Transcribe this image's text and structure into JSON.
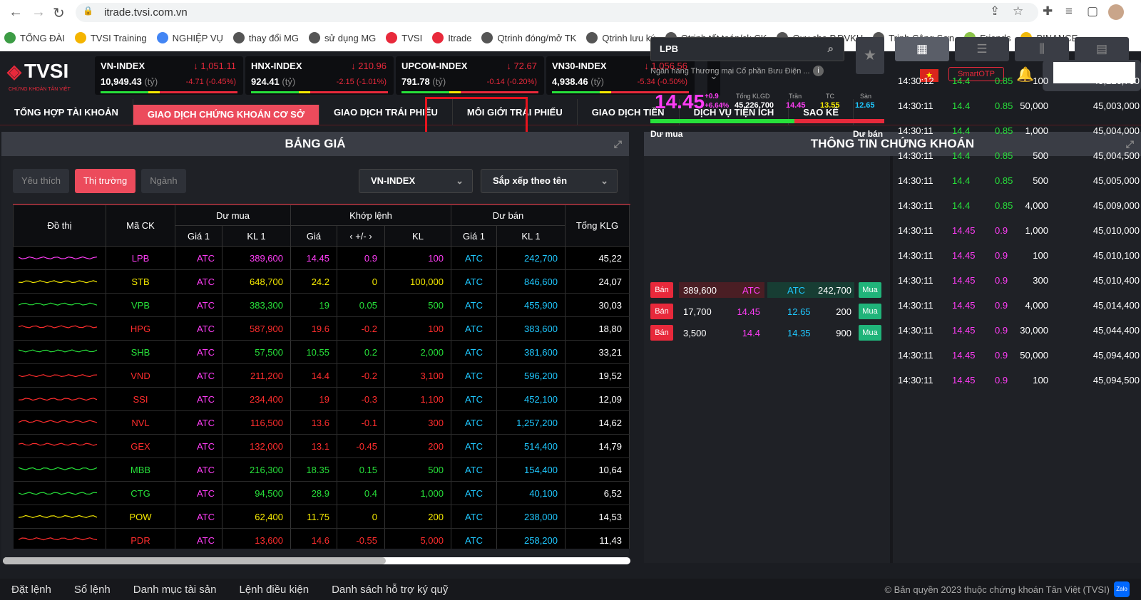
{
  "browser": {
    "url": "itrade.tvsi.com.vn",
    "bookmarks": [
      {
        "label": "TỔNG ĐÀI",
        "color": "#3c9c45"
      },
      {
        "label": "TVSI Training",
        "color": "#f4b400"
      },
      {
        "label": "NGHIỆP VỤ",
        "color": "#4285f4"
      },
      {
        "label": "thay đổi MG",
        "color": "#555"
      },
      {
        "label": "sử dụng MG",
        "color": "#555"
      },
      {
        "label": "TVSI",
        "color": "#e8293b"
      },
      {
        "label": "Itrade",
        "color": "#e8293b"
      },
      {
        "label": "Qtrinh đóng/mở TK",
        "color": "#555"
      },
      {
        "label": "Qtrinh lưu ký",
        "color": "#555"
      },
      {
        "label": "Qtrinh tất toán/ck CK",
        "color": "#555"
      },
      {
        "label": "Quy che P.DVKH",
        "color": "#555"
      },
      {
        "label": "Trịnh Công Sơn",
        "color": "#555"
      },
      {
        "label": "Friends",
        "color": "#8bc34a"
      },
      {
        "label": "BINANCE",
        "color": "#f0b90b"
      }
    ]
  },
  "logo": {
    "text": "TVSI",
    "subtitle": "CHỨNG KHOÁN TÂN VIỆT"
  },
  "indices": [
    {
      "name": "VN-INDEX",
      "price": "1,051.11",
      "volume": "10,949.43",
      "unit": "(tỷ)",
      "change": "-4.71",
      "pct": "(-0.45%)"
    },
    {
      "name": "HNX-INDEX",
      "price": "210.96",
      "volume": "924.41",
      "unit": "(tỷ)",
      "change": "-2.15",
      "pct": "(-1.01%)"
    },
    {
      "name": "UPCOM-INDEX",
      "price": "72.67",
      "volume": "791.78",
      "unit": "(tỷ)",
      "change": "-0.14",
      "pct": "(-0.20%)"
    },
    {
      "name": "VN30-INDEX",
      "price": "1,056.56",
      "volume": "4,938.46",
      "unit": "(tỷ)",
      "change": "-5.34",
      "pct": "(-0.50%)"
    }
  ],
  "header": {
    "smartotp": "SmartOTP",
    "flag": "★"
  },
  "menu": [
    "TỔNG HỢP TÀI KHOẢN",
    "GIAO DỊCH CHỨNG KHOÁN CƠ SỞ",
    "GIAO DỊCH TRÁI PHIẾU",
    "MÔI GIỚI TRÁI PHIẾU",
    "GIAO DỊCH TIỀN",
    "DỊCH VỤ TIỆN ÍCH",
    "SAO KÊ"
  ],
  "board": {
    "title": "BẢNG GIÁ",
    "tabs": [
      "Yêu thích",
      "Thị trường",
      "Ngành"
    ],
    "index_select": "VN-INDEX",
    "sort_select": "Sắp xếp theo tên",
    "headers": {
      "chart": "Đồ thị",
      "symbol": "Mã CK",
      "bid": "Dư mua",
      "match": "Khớp lệnh",
      "ask": "Dư bán",
      "total": "Tổng KLG",
      "price1": "Giá 1",
      "vol1": "KL 1",
      "price": "Giá",
      "change": "+/-",
      "vol": "KL"
    },
    "rows": [
      {
        "sym": "LPB",
        "bp": "ATC",
        "bv": "389,600",
        "mp": "14.45",
        "mc": "0.9",
        "mv": "100",
        "ap": "ATC",
        "av": "242,700",
        "tot": "45,22",
        "color": "#ff3df6"
      },
      {
        "sym": "STB",
        "bp": "ATC",
        "bv": "648,700",
        "mp": "24.2",
        "mc": "0",
        "mv": "100,000",
        "ap": "ATC",
        "av": "846,600",
        "tot": "24,07",
        "color": "#f5e900"
      },
      {
        "sym": "VPB",
        "bp": "ATC",
        "bv": "383,300",
        "mp": "19",
        "mc": "0.05",
        "mv": "500",
        "ap": "ATC",
        "av": "455,900",
        "tot": "30,03",
        "color": "#27e03a"
      },
      {
        "sym": "HPG",
        "bp": "ATC",
        "bv": "587,900",
        "mp": "19.6",
        "mc": "-0.2",
        "mv": "100",
        "ap": "ATC",
        "av": "383,600",
        "tot": "18,80",
        "color": "#ff2d2d"
      },
      {
        "sym": "SHB",
        "bp": "ATC",
        "bv": "57,500",
        "mp": "10.55",
        "mc": "0.2",
        "mv": "2,000",
        "ap": "ATC",
        "av": "381,600",
        "tot": "33,21",
        "color": "#27e03a"
      },
      {
        "sym": "VND",
        "bp": "ATC",
        "bv": "211,200",
        "mp": "14.4",
        "mc": "-0.2",
        "mv": "3,100",
        "ap": "ATC",
        "av": "596,200",
        "tot": "19,52",
        "color": "#ff2d2d"
      },
      {
        "sym": "SSI",
        "bp": "ATC",
        "bv": "234,400",
        "mp": "19",
        "mc": "-0.3",
        "mv": "1,100",
        "ap": "ATC",
        "av": "452,100",
        "tot": "12,09",
        "color": "#ff2d2d"
      },
      {
        "sym": "NVL",
        "bp": "ATC",
        "bv": "116,500",
        "mp": "13.6",
        "mc": "-0.1",
        "mv": "300",
        "ap": "ATC",
        "av": "1,257,200",
        "tot": "14,62",
        "color": "#ff2d2d"
      },
      {
        "sym": "GEX",
        "bp": "ATC",
        "bv": "132,000",
        "mp": "13.1",
        "mc": "-0.45",
        "mv": "200",
        "ap": "ATC",
        "av": "514,400",
        "tot": "14,79",
        "color": "#ff2d2d"
      },
      {
        "sym": "MBB",
        "bp": "ATC",
        "bv": "216,300",
        "mp": "18.35",
        "mc": "0.15",
        "mv": "500",
        "ap": "ATC",
        "av": "154,400",
        "tot": "10,64",
        "color": "#27e03a"
      },
      {
        "sym": "CTG",
        "bp": "ATC",
        "bv": "94,500",
        "mp": "28.9",
        "mc": "0.4",
        "mv": "1,000",
        "ap": "ATC",
        "av": "40,100",
        "tot": "6,52",
        "color": "#27e03a"
      },
      {
        "sym": "POW",
        "bp": "ATC",
        "bv": "62,400",
        "mp": "11.75",
        "mc": "0",
        "mv": "200",
        "ap": "ATC",
        "av": "238,000",
        "tot": "14,53",
        "color": "#f5e900"
      },
      {
        "sym": "PDR",
        "bp": "ATC",
        "bv": "13,600",
        "mp": "14.6",
        "mc": "-0.55",
        "mv": "5,000",
        "ap": "ATC",
        "av": "258,200",
        "tot": "11,43",
        "color": "#ff2d2d"
      }
    ]
  },
  "stock": {
    "title": "THÔNG TIN CHỨNG KHOÁN",
    "symbol": "LPB",
    "company": "Ngân hàng Thương mại Cổ phần Bưu Điện ...",
    "price": "14.45",
    "change": "+0.9",
    "pct": "+6.64%",
    "total_label": "Tổng KLGD",
    "total": "45,226,700",
    "ceil_label": "Trần",
    "ceil": "14.45",
    "ref_label": "TC",
    "ref": "13.55",
    "floor_label": "Sàn",
    "floor": "12.65",
    "bid_label": "Dư mua",
    "ask_label": "Dư bán",
    "sell_btn": "Bán",
    "buy_btn": "Mua",
    "orderbook": [
      {
        "bv": "389,600",
        "bp": "ATC",
        "ap": "ATC",
        "av": "242,700"
      },
      {
        "bv": "17,700",
        "bp": "14.45",
        "ap": "12.65",
        "av": "200"
      },
      {
        "bv": "3,500",
        "bp": "14.4",
        "ap": "14.35",
        "av": "900"
      }
    ],
    "trades": [
      {
        "t": "14:30:12",
        "p": "14.4",
        "c": "0.85",
        "v": "100",
        "tot": "45,226,700"
      },
      {
        "t": "14:30:11",
        "p": "14.4",
        "c": "0.85",
        "v": "50,000",
        "tot": "45,003,000"
      },
      {
        "t": "14:30:11",
        "p": "14.4",
        "c": "0.85",
        "v": "1,000",
        "tot": "45,004,000"
      },
      {
        "t": "14:30:11",
        "p": "14.4",
        "c": "0.85",
        "v": "500",
        "tot": "45,004,500"
      },
      {
        "t": "14:30:11",
        "p": "14.4",
        "c": "0.85",
        "v": "500",
        "tot": "45,005,000"
      },
      {
        "t": "14:30:11",
        "p": "14.4",
        "c": "0.85",
        "v": "4,000",
        "tot": "45,009,000"
      },
      {
        "t": "14:30:11",
        "p": "14.45",
        "c": "0.9",
        "v": "1,000",
        "tot": "45,010,000"
      },
      {
        "t": "14:30:11",
        "p": "14.45",
        "c": "0.9",
        "v": "100",
        "tot": "45,010,100"
      },
      {
        "t": "14:30:11",
        "p": "14.45",
        "c": "0.9",
        "v": "300",
        "tot": "45,010,400"
      },
      {
        "t": "14:30:11",
        "p": "14.45",
        "c": "0.9",
        "v": "4,000",
        "tot": "45,014,400"
      },
      {
        "t": "14:30:11",
        "p": "14.45",
        "c": "0.9",
        "v": "30,000",
        "tot": "45,044,400"
      },
      {
        "t": "14:30:11",
        "p": "14.45",
        "c": "0.9",
        "v": "50,000",
        "tot": "45,094,400"
      },
      {
        "t": "14:30:11",
        "p": "14.45",
        "c": "0.9",
        "v": "100",
        "tot": "45,094,500"
      }
    ]
  },
  "footer": {
    "items": [
      "Đặt lệnh",
      "Sổ lệnh",
      "Danh mục tài sản",
      "Lệnh điều kiện",
      "Danh sách hỗ trợ ký quỹ"
    ],
    "copyright": "© Bản quyền 2023 thuộc chứng khoán Tân Việt (TVSI)",
    "zalo": "Zalo"
  }
}
